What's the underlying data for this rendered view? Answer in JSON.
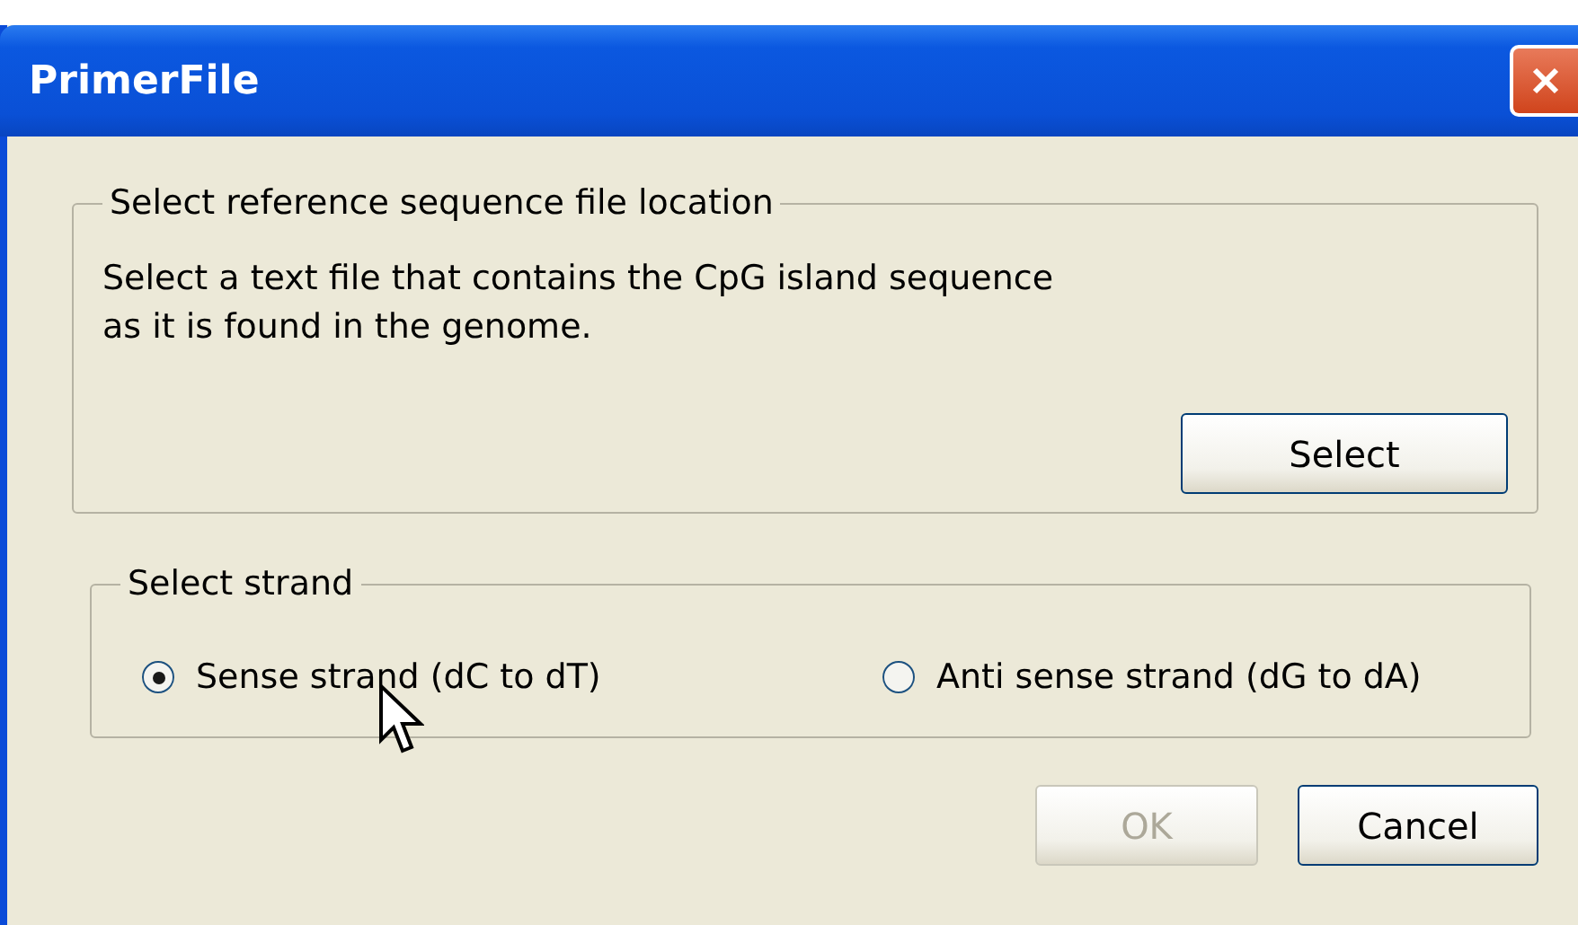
{
  "window": {
    "title": "PrimerFile"
  },
  "reference_group": {
    "legend": "Select reference sequence file location",
    "description_lines": [
      "Select a text file that contains the CpG island sequence",
      "as it is found in the genome."
    ],
    "button": "Select"
  },
  "strand_group": {
    "legend": "Select strand",
    "options": [
      {
        "label": "Sense strand (dC to dT)",
        "selected": true
      },
      {
        "label": "Anti sense strand (dG to dA)",
        "selected": false
      }
    ]
  },
  "buttons": [
    {
      "label": "OK",
      "disabled": true
    },
    {
      "label": "Cancel",
      "disabled": false
    }
  ]
}
